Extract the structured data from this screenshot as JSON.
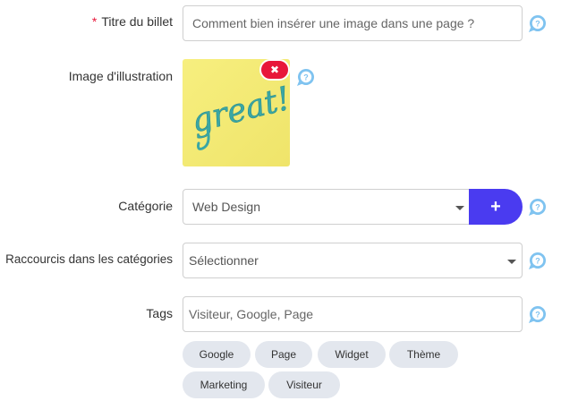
{
  "form": {
    "title_field": {
      "required_mark": "*",
      "label": "Titre du billet",
      "placeholder": "Comment bien insérer une image dans une page ?"
    },
    "image_field": {
      "label": "Image d'illustration",
      "image_text": "great!",
      "remove_label": "✖"
    },
    "category_field": {
      "label": "Catégorie",
      "selected": "Web Design",
      "add_label": "+"
    },
    "shortcuts_field": {
      "label": "Raccourcis dans les catégories",
      "selected": "Sélectionner"
    },
    "tags_field": {
      "label": "Tags",
      "placeholder": "Visiteur, Google, Page",
      "suggestions": [
        "Google",
        "Page",
        "Widget",
        "Thème",
        "Marketing",
        "Visiteur"
      ]
    }
  },
  "colors": {
    "accent": "#4a3bf0",
    "danger": "#e8173a",
    "help_icon": "#7fc3f0",
    "chip_bg": "#e3e7ee",
    "postit": "#f5ec78"
  },
  "icons": {
    "help": "question-circle-icon",
    "remove": "close-icon",
    "add": "plus-icon",
    "dropdown": "caret-down-icon"
  }
}
